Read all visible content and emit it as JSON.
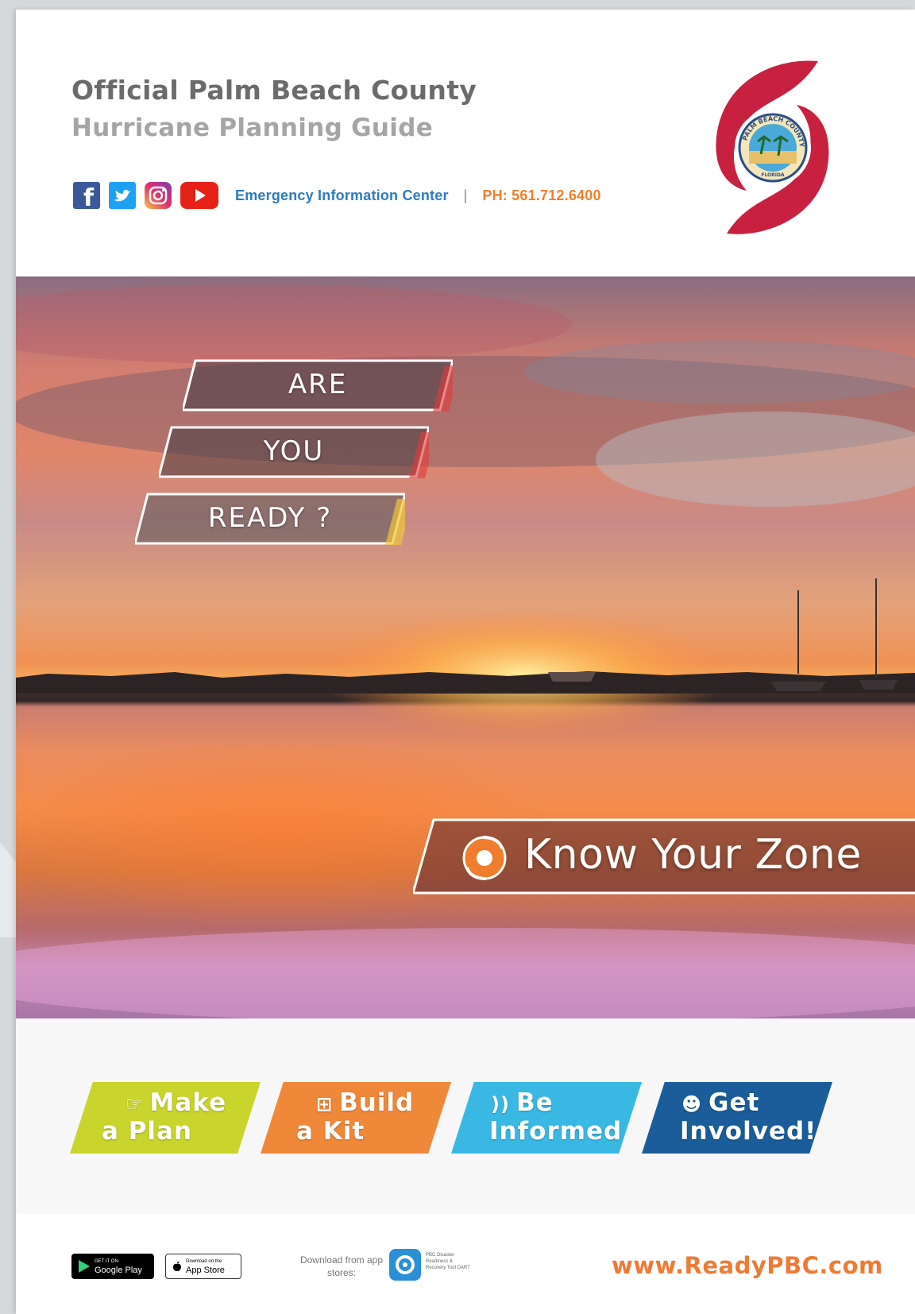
{
  "header": {
    "title": "Official Palm Beach County",
    "subtitle": "Hurricane Planning Guide",
    "social": [
      {
        "icon": "facebook-icon",
        "color": "#3b5998"
      },
      {
        "icon": "twitter-icon",
        "color": "#1da1f2"
      },
      {
        "icon": "instagram-icon",
        "color": "#d6249f"
      },
      {
        "icon": "youtube-icon",
        "color": "#e62117"
      }
    ],
    "contact_label": "Emergency Information Center",
    "separator": "|",
    "phone": "PH: 561.712.6400"
  },
  "logo": {
    "icon": "hurricane-symbol-icon",
    "seal_text": "PALM BEACH COUNTY",
    "seal_state": "FLORIDA",
    "color": "#c8203f"
  },
  "hero": {
    "lines": [
      "ARE",
      "YOU",
      "READY ?"
    ],
    "zone_label": "Know Your Zone"
  },
  "actions": [
    {
      "icon": "hand-pointer-icon",
      "line1": "Make",
      "line2": "a Plan",
      "color": "#c9d52c"
    },
    {
      "icon": "first-aid-kit-icon",
      "line1": "Build",
      "line2": "a Kit",
      "color": "#f0883a"
    },
    {
      "icon": "rss-feed-icon",
      "line1": "Be",
      "line2": "Informed",
      "color": "#39b8e3"
    },
    {
      "icon": "people-icon",
      "line1": "Get",
      "line2": "Involved!",
      "color": "#1a5d9a"
    }
  ],
  "footer": {
    "google_play": "Google Play",
    "google_play_small": "GET IT ON",
    "app_store": "App Store",
    "app_store_small": "Download on the",
    "download_note": "Download from app stores:",
    "app_name": "PBC Disaster Readiness & Recovery Tool DART",
    "website": "www.ReadyPBC.com"
  }
}
